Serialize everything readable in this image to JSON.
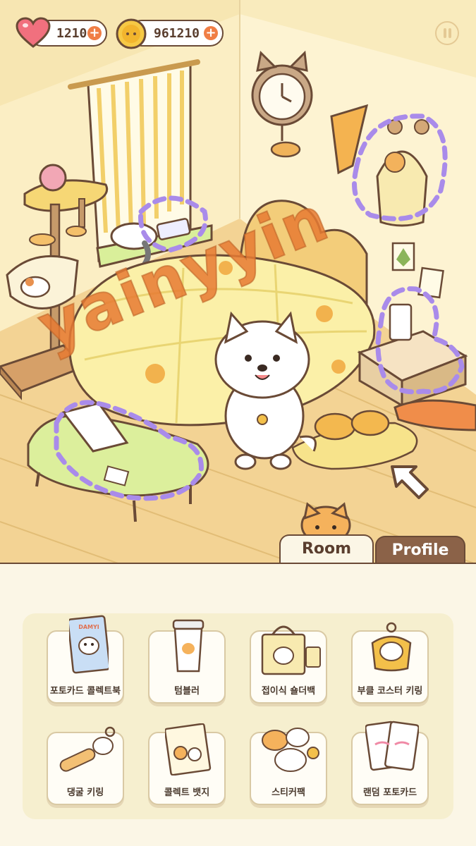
{
  "hud": {
    "hearts": "1210",
    "coins": "961210",
    "plus_symbol": "+"
  },
  "room": {
    "watermark": "yainyyin",
    "tabs": [
      {
        "label": "Room",
        "selected": true
      },
      {
        "label": "Profile",
        "selected": false
      }
    ]
  },
  "shop": {
    "items": [
      {
        "label": "포토카드 콜렉트북",
        "badge": "DAMYI"
      },
      {
        "label": "텀블러"
      },
      {
        "label": "접이식 숄더백"
      },
      {
        "label": "부클 코스터 키링"
      },
      {
        "label": "댕굴 키링"
      },
      {
        "label": "콜렉트 뱃지"
      },
      {
        "label": "스티커팩"
      },
      {
        "label": "랜덤 포토카드"
      }
    ]
  },
  "colors": {
    "accent": "#f07e45",
    "outline": "#6a4a36",
    "wall": "#fcefc6",
    "floor": "#f3d394",
    "shop_panel": "#f6efcf",
    "highlight_dash": "#a98bea"
  }
}
